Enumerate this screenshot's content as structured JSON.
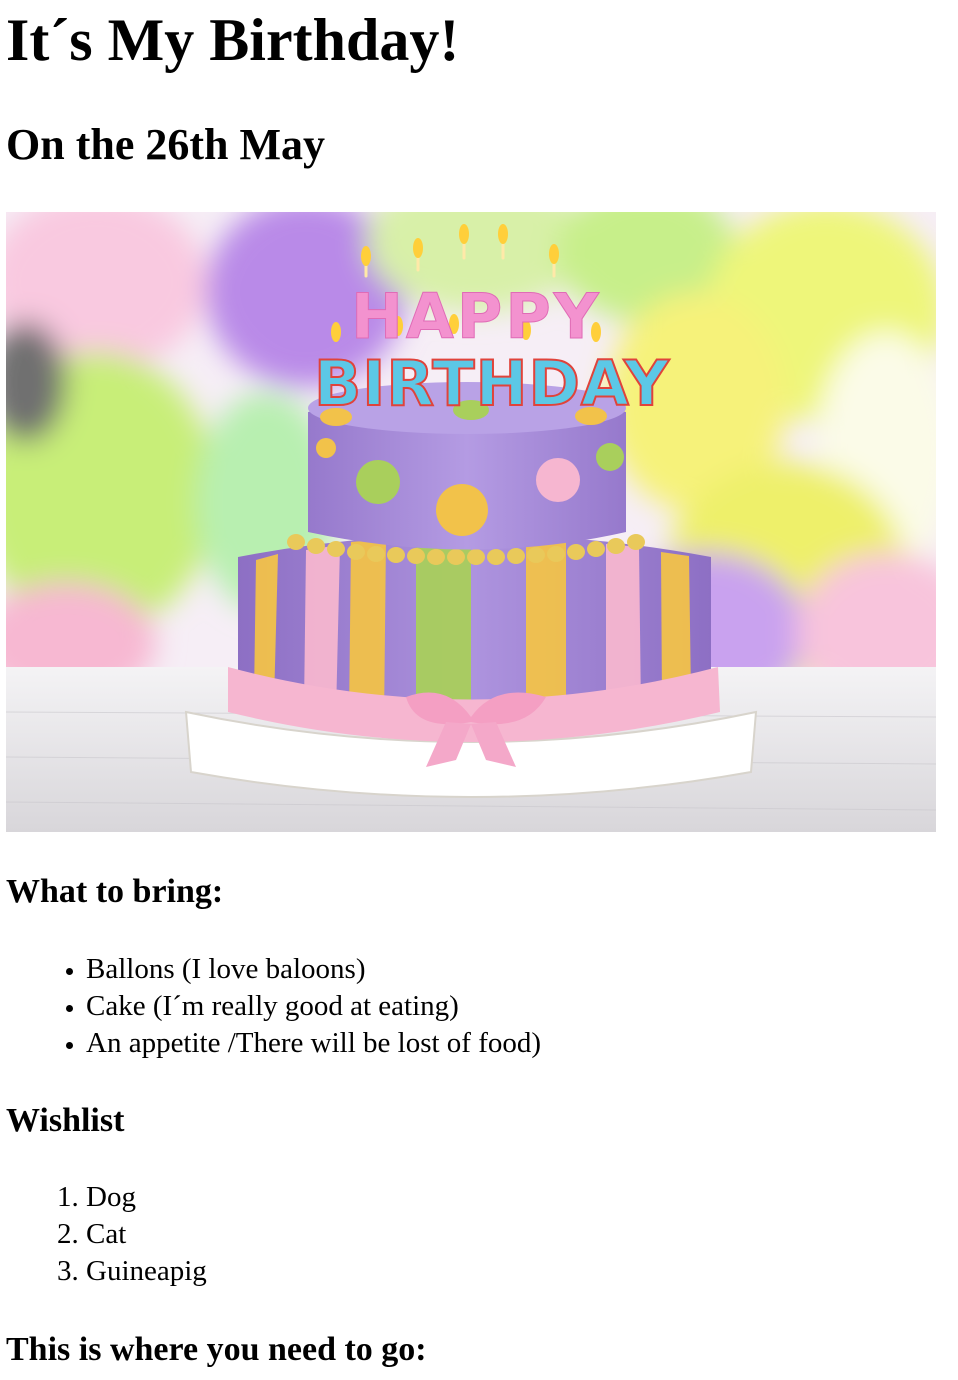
{
  "page": {
    "title": "It´s My Birthday!",
    "subtitle": "On the 26th May"
  },
  "hero_image": {
    "alt": "HAPPY BIRTHDAY",
    "candle_line1": "HAPPY",
    "candle_line2": "BIRTHDAY",
    "colors": {
      "cake_purple": "#a78bd6",
      "stripe_yellow": "#f2c24a",
      "stripe_green": "#a9cf5c",
      "stripe_pink": "#f6b6d0",
      "balloon_yellow": "#f3f27a",
      "balloon_green": "#c7ef8a",
      "balloon_purple": "#c9a2ef"
    }
  },
  "bring": {
    "heading": "What to bring:",
    "items": [
      "Ballons (I love baloons)",
      "Cake (I´m really good at eating)",
      "An appetite /There will be lost of food)"
    ]
  },
  "wishlist": {
    "heading": "Wishlist",
    "items": [
      "Dog",
      "Cat",
      "Guineapig"
    ]
  },
  "directions": {
    "heading": "This is where you need to go:"
  }
}
